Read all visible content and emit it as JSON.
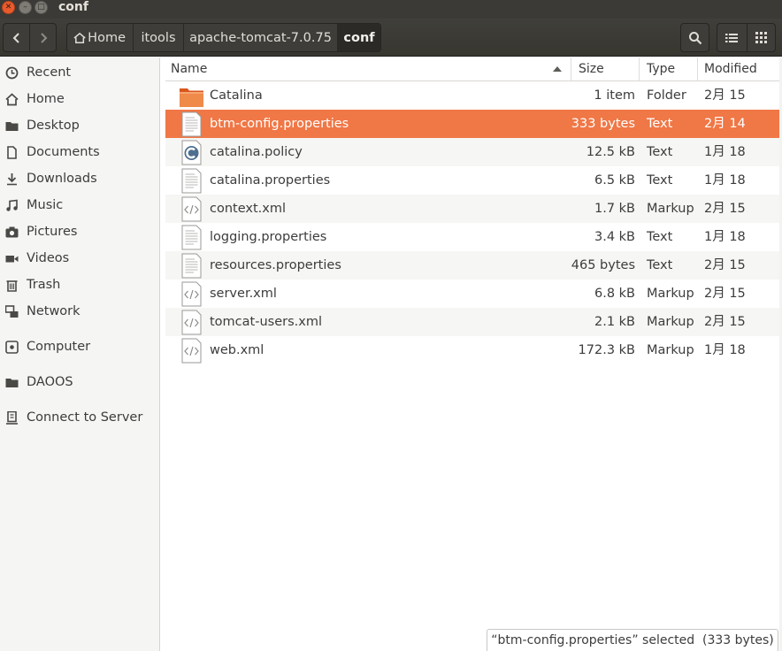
{
  "window": {
    "title": "conf"
  },
  "header": {
    "breadcrumbs": [
      {
        "label": "Home",
        "icon": "home-icon"
      },
      {
        "label": "itools"
      },
      {
        "label": "apache-tomcat-7.0.75"
      },
      {
        "label": "conf"
      }
    ],
    "back_icon": "chevron-left-icon",
    "forward_icon": "chevron-right-icon",
    "search_icon": "search-icon",
    "list_view_icon": "list-view-icon",
    "grid_view_icon": "grid-view-icon"
  },
  "sidebar": {
    "items": [
      {
        "label": "Recent",
        "icon": "clock-icon"
      },
      {
        "label": "Home",
        "icon": "home-icon"
      },
      {
        "label": "Desktop",
        "icon": "folder-icon"
      },
      {
        "label": "Documents",
        "icon": "document-icon"
      },
      {
        "label": "Downloads",
        "icon": "download-icon"
      },
      {
        "label": "Music",
        "icon": "music-icon"
      },
      {
        "label": "Pictures",
        "icon": "camera-icon"
      },
      {
        "label": "Videos",
        "icon": "video-icon"
      },
      {
        "label": "Trash",
        "icon": "trash-icon"
      },
      {
        "label": "Network",
        "icon": "network-icon"
      },
      {
        "label": "Computer",
        "icon": "computer-icon"
      },
      {
        "label": "DAOOS",
        "icon": "folder-icon"
      },
      {
        "label": "Connect to Server",
        "icon": "server-icon"
      }
    ]
  },
  "columns": {
    "name": "Name",
    "size": "Size",
    "type": "Type",
    "modified": "Modified"
  },
  "files": [
    {
      "name": "Catalina",
      "size": "1 item",
      "type": "Folder",
      "modified": "2月 15",
      "icon": "folder-icon"
    },
    {
      "name": "btm-config.properties",
      "size": "333 bytes",
      "type": "Text",
      "modified": "2月 14",
      "icon": "text-file-icon",
      "selected": true
    },
    {
      "name": "catalina.policy",
      "size": "12.5 kB",
      "type": "Text",
      "modified": "1月 18",
      "icon": "policy-file-icon"
    },
    {
      "name": "catalina.properties",
      "size": "6.5 kB",
      "type": "Text",
      "modified": "1月 18",
      "icon": "text-file-icon"
    },
    {
      "name": "context.xml",
      "size": "1.7 kB",
      "type": "Markup",
      "modified": "2月 15",
      "icon": "markup-file-icon"
    },
    {
      "name": "logging.properties",
      "size": "3.4 kB",
      "type": "Text",
      "modified": "1月 18",
      "icon": "text-file-icon"
    },
    {
      "name": "resources.properties",
      "size": "465 bytes",
      "type": "Text",
      "modified": "2月 15",
      "icon": "text-file-icon"
    },
    {
      "name": "server.xml",
      "size": "6.8 kB",
      "type": "Markup",
      "modified": "2月 15",
      "icon": "markup-file-icon"
    },
    {
      "name": "tomcat-users.xml",
      "size": "2.1 kB",
      "type": "Markup",
      "modified": "2月 15",
      "icon": "markup-file-icon"
    },
    {
      "name": "web.xml",
      "size": "172.3 kB",
      "type": "Markup",
      "modified": "1月 18",
      "icon": "markup-file-icon"
    }
  ],
  "status": {
    "text": "“btm-config.properties” selected  (333 bytes)"
  },
  "colors": {
    "accent": "#f07746",
    "titlebar": "#3b3a36",
    "close_button": "#e95a2c",
    "folder": "#ec7a3c"
  }
}
